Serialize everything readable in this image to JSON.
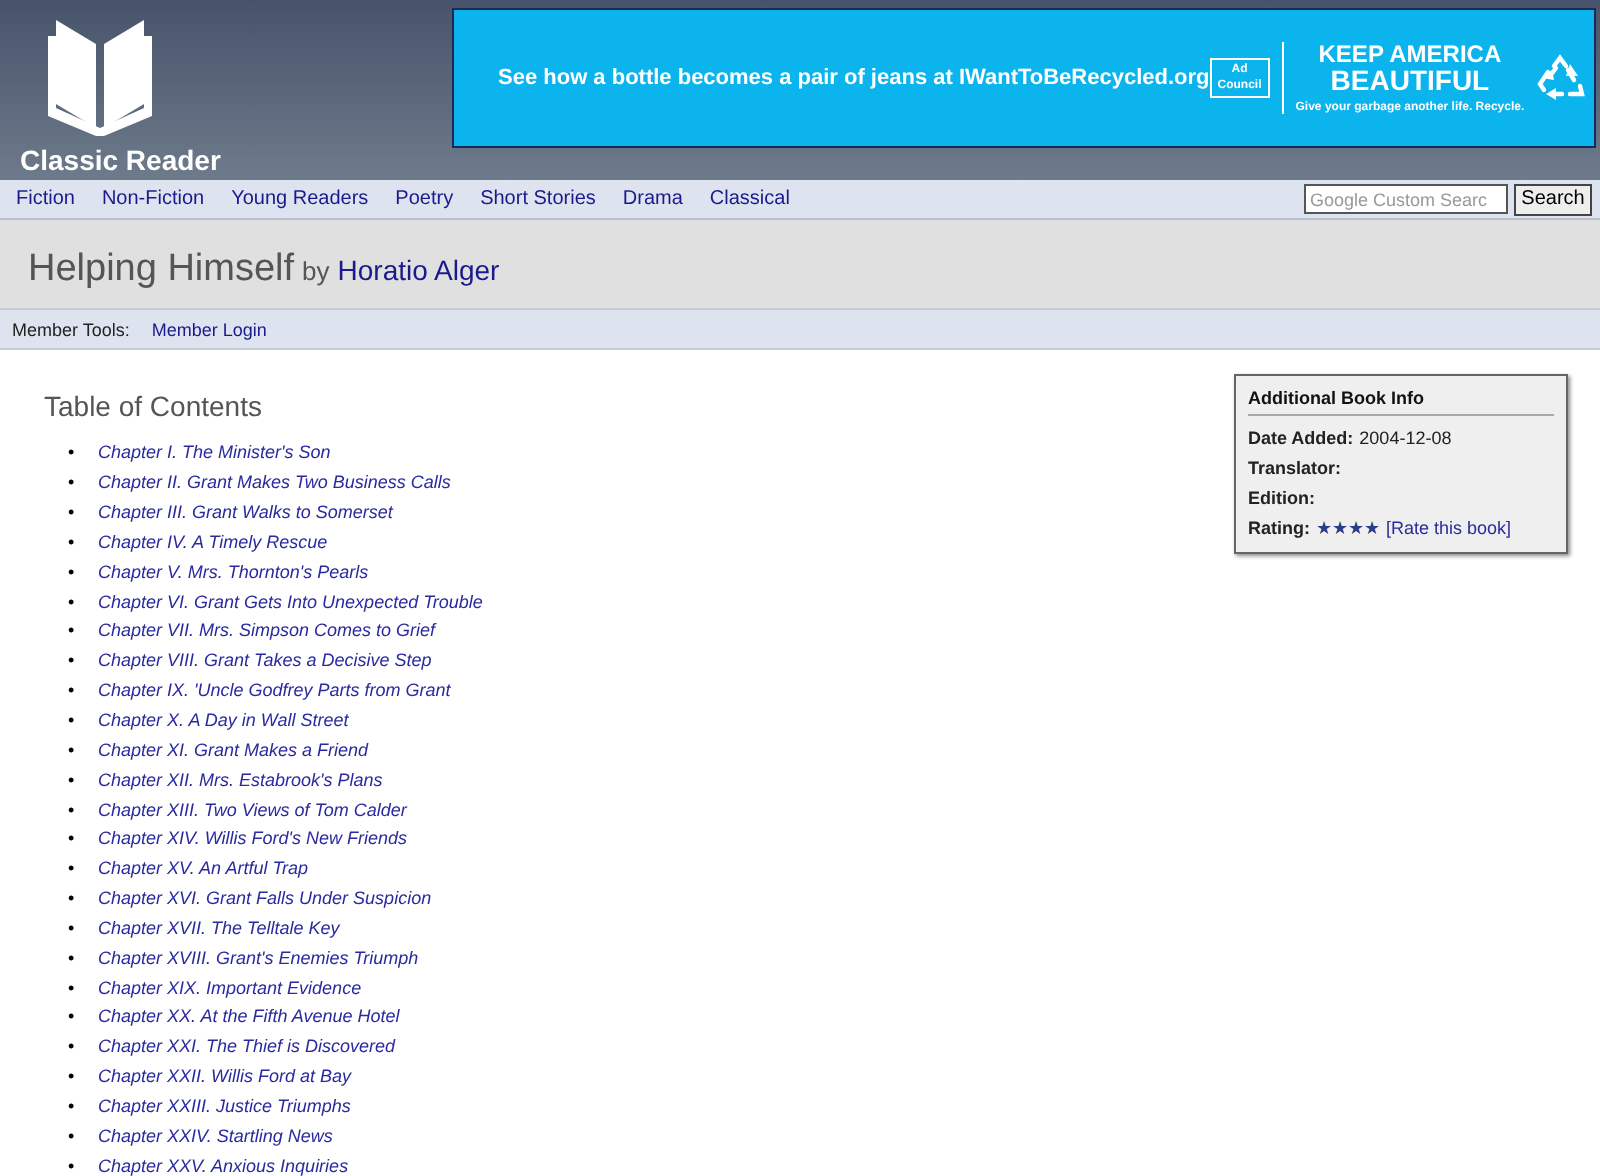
{
  "site": {
    "name": "Classic Reader"
  },
  "ad": {
    "headline": "See how a bottle becomes a pair of jeans at IWantToBeRecycled.org",
    "badge": "Ad Council",
    "brand_line_1": "KEEP AMERICA",
    "brand_line_2": "BEAUTIFUL",
    "tagline": "Give your garbage another life. Recycle."
  },
  "nav": {
    "items": [
      "Fiction",
      "Non-Fiction",
      "Young Readers",
      "Poetry",
      "Short Stories",
      "Drama",
      "Classical"
    ],
    "search": {
      "placeholder": "Google Custom Searc",
      "button": "Search"
    }
  },
  "book": {
    "title": "Helping Himself",
    "by": "by",
    "author": "Horatio Alger"
  },
  "member_tools": {
    "label": "Member Tools:",
    "link": "Member Login"
  },
  "toc": {
    "heading": "Table of Contents",
    "chapters": [
      {
        "marker": "•",
        "title": "Chapter I. The Minister's Son"
      },
      {
        "marker": "•",
        "title": "Chapter II. Grant Makes Two Business Calls"
      },
      {
        "marker": "•",
        "title": "Chapter III. Grant Walks to Somerset"
      },
      {
        "marker": "•",
        "title": "Chapter IV. A Timely Rescue"
      },
      {
        "marker": "•",
        "title": "Chapter V. Mrs. Thornton's Pearls"
      },
      {
        "marker": "•",
        "title": "Chapter VI. Grant Gets Into Unexpected Trouble"
      },
      {
        "marker": "•",
        "title": "Chapter VII. Mrs. Simpson Comes to Grief"
      },
      {
        "marker": "•",
        "title": "Chapter VIII. Grant Takes a Decisive Step"
      },
      {
        "marker": "•",
        "title": "Chapter IX. 'Uncle Godfrey Parts from Grant"
      },
      {
        "marker": "•",
        "title": "Chapter X. A Day in Wall Street"
      },
      {
        "marker": "•",
        "title": "Chapter XI. Grant Makes a Friend"
      },
      {
        "marker": "•",
        "title": "Chapter XII. Mrs. Estabrook's Plans"
      },
      {
        "marker": "•",
        "title": "Chapter XIII. Two Views of Tom Calder"
      },
      {
        "marker": "•",
        "title": "Chapter XIV. Willis Ford's New Friends"
      },
      {
        "marker": "•",
        "title": "Chapter XV. An Artful Trap"
      },
      {
        "marker": "•",
        "title": "Chapter XVI. Grant Falls Under Suspicion"
      },
      {
        "marker": "•",
        "title": "Chapter XVII. The Telltale Key"
      },
      {
        "marker": "•",
        "title": "Chapter XVIII. Grant's Enemies Triumph"
      },
      {
        "marker": "•",
        "title": "Chapter XIX. Important Evidence"
      },
      {
        "marker": "•",
        "title": "Chapter XX. At the Fifth Avenue Hotel"
      },
      {
        "marker": "•",
        "title": "Chapter XXI. The Thief is Discovered"
      },
      {
        "marker": "•",
        "title": "Chapter XXII. Willis Ford at Bay"
      },
      {
        "marker": "•",
        "title": "Chapter XXIII. Justice Triumphs"
      },
      {
        "marker": "•",
        "title": "Chapter XXIV. Startling News"
      },
      {
        "marker": "•",
        "title": "Chapter XXV. Anxious Inquiries"
      }
    ]
  },
  "info": {
    "title": "Additional Book Info",
    "fields": [
      {
        "label": "Date Added:",
        "value": "2004-12-08"
      },
      {
        "label": "Translator:"
      },
      {
        "label": "Edition:"
      }
    ],
    "rating": {
      "label": "Rating:",
      "stars": 4,
      "link": "[Rate this book]"
    }
  }
}
